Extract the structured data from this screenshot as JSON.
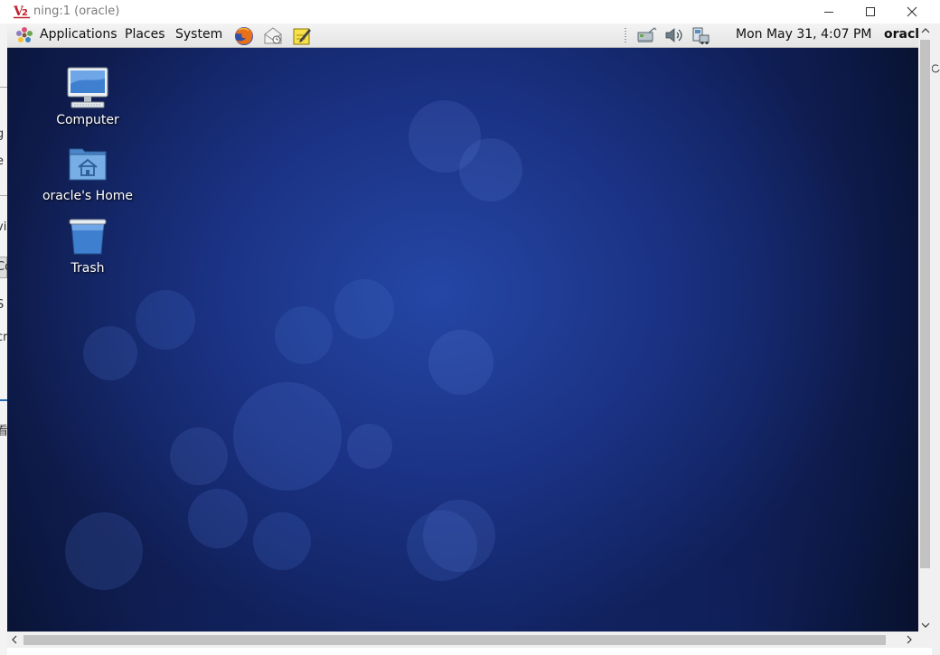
{
  "window": {
    "title": "ning:1 (oracle)",
    "icon": "vnc-viewer-icon",
    "controls": [
      "minimize",
      "maximize",
      "close"
    ]
  },
  "panel": {
    "menus": [
      "Applications",
      "Places",
      "System"
    ],
    "launchers": [
      "firefox-icon",
      "mail-icon",
      "notes-icon"
    ],
    "tray": [
      "network-icon",
      "volume-icon",
      "update-notifier-icon"
    ],
    "clock": "Mon May 31,  4:07 PM",
    "user": "oracl"
  },
  "desktop": {
    "icons": [
      {
        "label": "Computer",
        "icon": "computer-icon"
      },
      {
        "label": "oracle's Home",
        "icon": "home-folder-icon"
      },
      {
        "label": "Trash",
        "icon": "trash-icon"
      }
    ]
  },
  "background_app": {
    "fragments": [
      "g",
      "e",
      "vi",
      "Co",
      "S",
      "cr",
      "看"
    ]
  },
  "colors": {
    "desktop_blue": "#142a72",
    "panel_bg": "#e8e8e8",
    "title_text": "#7a7a7a",
    "vnc_red": "#c0202c"
  }
}
